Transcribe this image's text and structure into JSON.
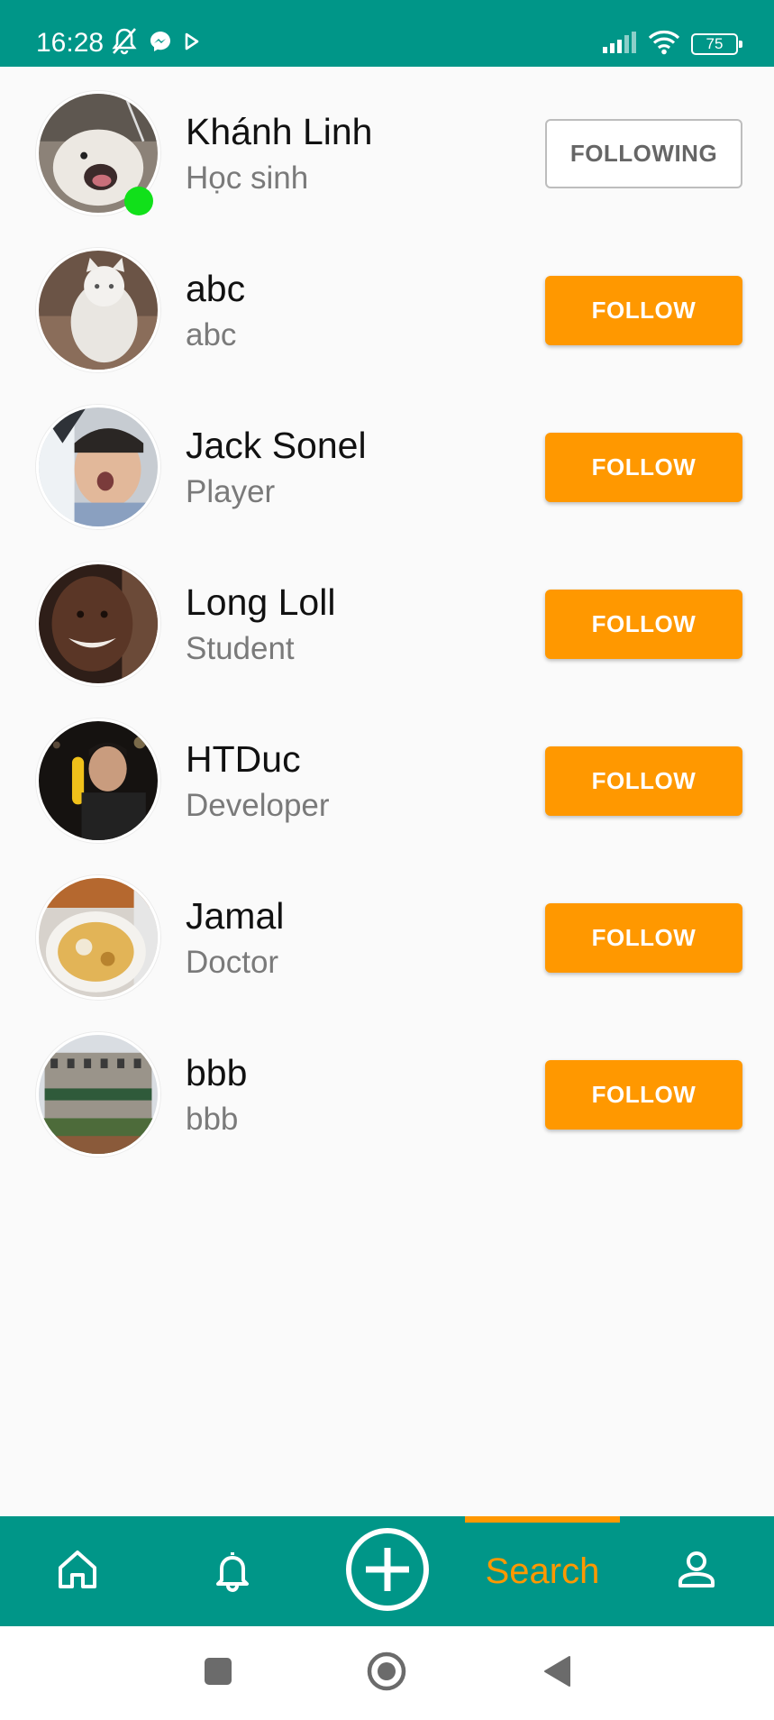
{
  "status_bar": {
    "time": "16:28",
    "battery": "75",
    "left_icons": [
      "bell-off-icon",
      "messenger-icon",
      "play-icon"
    ],
    "right_icons": [
      "signal-icon",
      "wifi-icon",
      "battery-icon"
    ]
  },
  "users": [
    {
      "name": "Khánh Linh",
      "title": "Học sinh",
      "button": "FOLLOWING",
      "following": true,
      "online": true
    },
    {
      "name": "abc",
      "title": "abc",
      "button": "FOLLOW",
      "following": false,
      "online": false
    },
    {
      "name": "Jack Sonel",
      "title": "Player",
      "button": "FOLLOW",
      "following": false,
      "online": false
    },
    {
      "name": "Long Loll",
      "title": "Student",
      "button": "FOLLOW",
      "following": false,
      "online": false
    },
    {
      "name": "HTDuc",
      "title": "Developer",
      "button": "FOLLOW",
      "following": false,
      "online": false
    },
    {
      "name": "Jamal",
      "title": "Doctor",
      "button": "FOLLOW",
      "following": false,
      "online": false
    },
    {
      "name": "bbb",
      "title": "bbb",
      "button": "FOLLOW",
      "following": false,
      "online": false
    }
  ],
  "bottom_nav": {
    "items": [
      "home-icon",
      "bell-icon",
      "add-circle-icon",
      "search-tab",
      "profile-icon"
    ],
    "search_label": "Search",
    "active": "search-tab"
  },
  "system_nav": [
    "recents-button",
    "home-button",
    "back-button"
  ],
  "colors": {
    "primary": "#009688",
    "accent": "#ff9800",
    "online": "#11e01a",
    "background": "#fafafa"
  }
}
